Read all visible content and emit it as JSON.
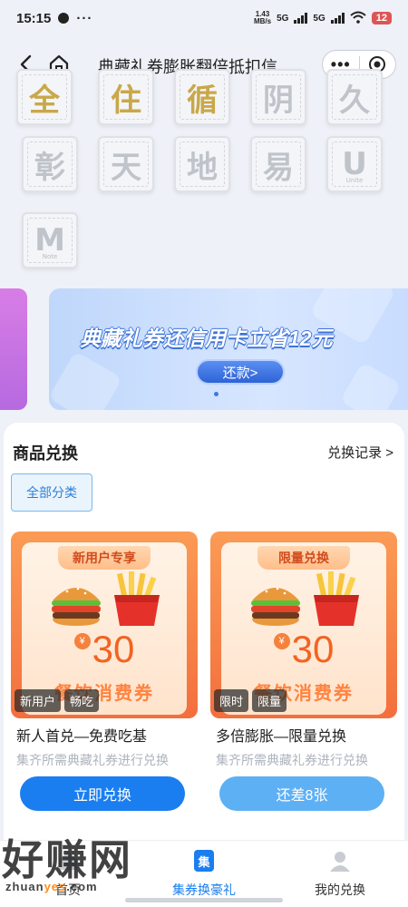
{
  "status_bar": {
    "time": "15:15",
    "more": "···",
    "net_speed_value": "1.43",
    "net_speed_unit": "MB/s",
    "sim1": "5G",
    "sim2": "5G",
    "battery": "12"
  },
  "nav": {
    "title": "典藏礼券膨胀翻倍抵扣信…"
  },
  "tiles": [
    {
      "char": "全",
      "lit": true
    },
    {
      "char": "住",
      "lit": true
    },
    {
      "char": "循",
      "lit": true
    },
    {
      "char": "阴",
      "lit": false
    },
    {
      "char": "久",
      "lit": false
    },
    {
      "char": "彰",
      "lit": false
    },
    {
      "char": "天",
      "lit": false
    },
    {
      "char": "地",
      "lit": false
    },
    {
      "char": "易",
      "lit": false
    },
    {
      "char": "U",
      "lit": false,
      "sub": "Unite"
    },
    {
      "char": "M",
      "lit": false,
      "sub": "Note"
    }
  ],
  "banner": {
    "headline": "典藏礼券还信用卡立省12元",
    "button": "还款>"
  },
  "goods": {
    "title": "商品兑换",
    "record_link": "兑换记录 >",
    "category": "全部分类",
    "items": [
      {
        "ribbon": "新用户专享",
        "currency": "¥",
        "amount": "30",
        "coupon_subtitle": "餐饮消费券",
        "tags": [
          "新用户",
          "畅吃"
        ],
        "name": "新人首兑—免费吃基",
        "desc": "集齐所需典藏礼券进行兑换",
        "action": "立即兑换"
      },
      {
        "ribbon": "限量兑换",
        "currency": "¥",
        "amount": "30",
        "coupon_subtitle": "餐饮消费券",
        "tags": [
          "限时",
          "限量"
        ],
        "name": "多倍膨胀—限量兑换",
        "desc": "集齐所需典藏礼券进行兑换",
        "action": "还差8张"
      }
    ]
  },
  "tabbar": {
    "tabs": [
      {
        "label": "首页"
      },
      {
        "label": "集券换豪礼",
        "icon_text": "集"
      },
      {
        "label": "我的兑换"
      }
    ]
  },
  "watermark": {
    "big": "好赚网",
    "small_pre": "zhuan",
    "small_mid": "yes",
    "small_post": ".com"
  },
  "colors": {
    "accent": "#1a7ef0",
    "coupon_orange": "#f36f3d",
    "background": "#eef1f7"
  }
}
